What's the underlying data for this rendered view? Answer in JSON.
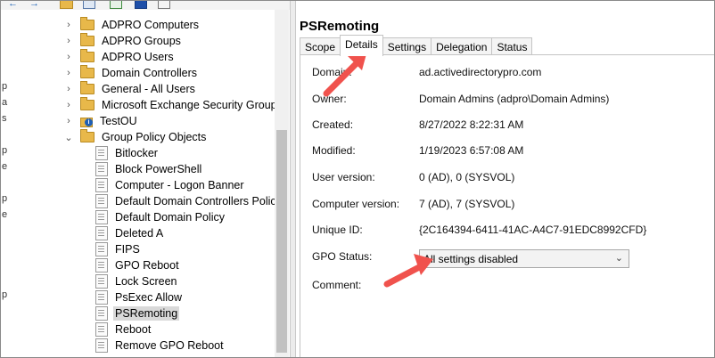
{
  "toolbar": {
    "icons": [
      "back-arrow-icon",
      "forward-arrow-icon",
      "folder-icon",
      "properties-icon",
      "refresh-icon",
      "help-icon",
      "console-icon"
    ]
  },
  "left_strip": [
    "p",
    "a",
    "s",
    "p",
    "e",
    "p",
    "e",
    "p"
  ],
  "tree": {
    "items": [
      {
        "label": "ADPRO Computers",
        "type": "folder",
        "expander": "›"
      },
      {
        "label": "ADPRO Groups",
        "type": "folder",
        "expander": "›"
      },
      {
        "label": "ADPRO Users",
        "type": "folder",
        "expander": "›"
      },
      {
        "label": "Domain Controllers",
        "type": "folder",
        "expander": "›"
      },
      {
        "label": "General - All Users",
        "type": "folder",
        "expander": "›"
      },
      {
        "label": "Microsoft Exchange Security Groups",
        "type": "folder",
        "expander": "›"
      },
      {
        "label": "TestOU",
        "type": "ou",
        "expander": "›"
      },
      {
        "label": "Group Policy Objects",
        "type": "folder",
        "expander": "⌄"
      },
      {
        "label": "Bitlocker",
        "type": "gpo"
      },
      {
        "label": "Block PowerShell",
        "type": "gpo"
      },
      {
        "label": "Computer - Logon Banner",
        "type": "gpo"
      },
      {
        "label": "Default Domain Controllers Policy",
        "type": "gpo"
      },
      {
        "label": "Default Domain Policy",
        "type": "gpo"
      },
      {
        "label": "Deleted A",
        "type": "gpo"
      },
      {
        "label": "FIPS",
        "type": "gpo"
      },
      {
        "label": "GPO Reboot",
        "type": "gpo"
      },
      {
        "label": "Lock Screen",
        "type": "gpo"
      },
      {
        "label": "PsExec Allow",
        "type": "gpo"
      },
      {
        "label": "PSRemoting",
        "type": "gpo",
        "selected": true
      },
      {
        "label": "Reboot",
        "type": "gpo"
      },
      {
        "label": "Remove GPO Reboot",
        "type": "gpo"
      }
    ]
  },
  "details": {
    "title": "PSRemoting",
    "tabs": [
      "Scope",
      "Details",
      "Settings",
      "Delegation",
      "Status"
    ],
    "active_tab": "Details",
    "rows": [
      {
        "label": "Domain:",
        "value": "ad.activedirectorypro.com"
      },
      {
        "label": "Owner:",
        "value": "Domain Admins (adpro\\Domain Admins)"
      },
      {
        "label": "Created:",
        "value": "8/27/2022 8:22:31 AM"
      },
      {
        "label": "Modified:",
        "value": "1/19/2023 6:57:08 AM"
      },
      {
        "label": "User version:",
        "value": "0 (AD), 0 (SYSVOL)"
      },
      {
        "label": "Computer version:",
        "value": "7 (AD), 7 (SYSVOL)"
      },
      {
        "label": "Unique ID:",
        "value": "{2C164394-6411-41AC-A4C7-91EDC8992CFD}"
      }
    ],
    "gpo_status_label": "GPO Status:",
    "gpo_status_value": "All settings disabled",
    "comment_label": "Comment:"
  },
  "annotations": {
    "arrow_color": "#f0524d"
  }
}
